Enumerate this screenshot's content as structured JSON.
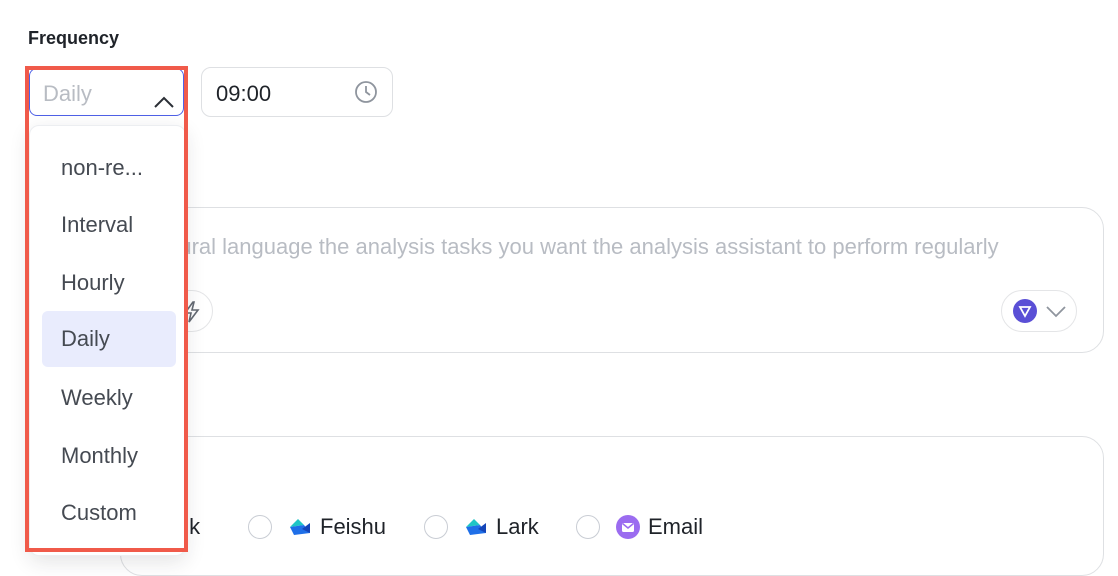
{
  "frequency": {
    "label": "Frequency",
    "select_value": "Daily",
    "time_value": "09:00",
    "options": [
      "non-re...",
      "Interval",
      "Hourly",
      "Daily",
      "Weekly",
      "Monthly",
      "Custom"
    ],
    "selected_option": "Daily"
  },
  "prompt": {
    "placeholder": "atural language the analysis tasks you want the analysis assistant to perform regularly"
  },
  "notification": {
    "channels": [
      {
        "label": "alk",
        "icon": "dingtalk-icon"
      },
      {
        "label": "Feishu",
        "icon": "feishu-icon"
      },
      {
        "label": "Lark",
        "icon": "lark-icon"
      },
      {
        "label": "Email",
        "icon": "email-icon"
      }
    ]
  },
  "colors": {
    "accent": "#4f61e6",
    "selected_bg": "#e9ecfd",
    "highlight": "#f05a4a",
    "email_icon": "#9b6cf0",
    "feishu_icon": "#1f6fe8"
  }
}
